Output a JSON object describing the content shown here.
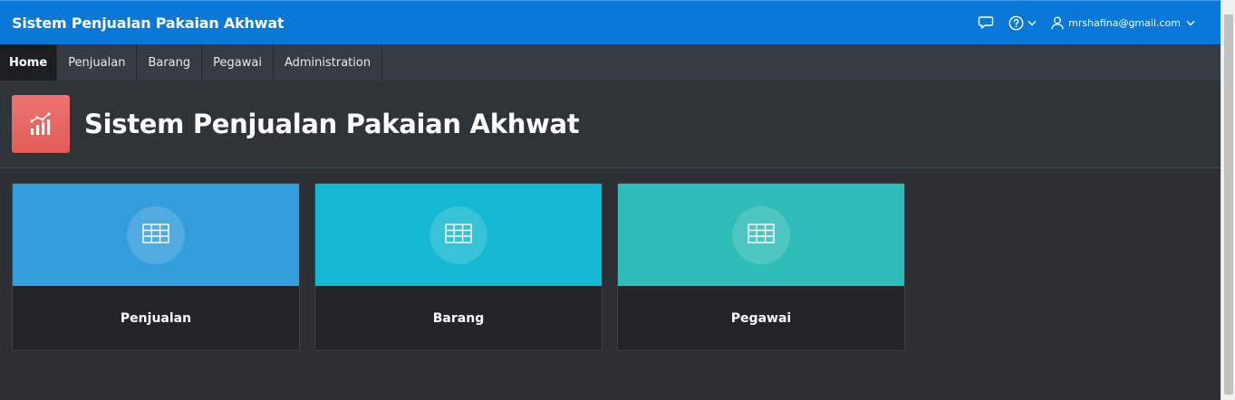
{
  "header": {
    "app_title": "Sistem Penjualan Pakaian Akhwat",
    "user_email": "mrshafina@gmail.com",
    "icons": [
      "chat-icon",
      "help-icon",
      "user-icon"
    ]
  },
  "nav": {
    "items": [
      {
        "label": "Home",
        "active": true
      },
      {
        "label": "Penjualan",
        "active": false
      },
      {
        "label": "Barang",
        "active": false
      },
      {
        "label": "Pegawai",
        "active": false
      },
      {
        "label": "Administration",
        "active": false
      }
    ]
  },
  "hero": {
    "title": "Sistem Penjualan Pakaian Akhwat",
    "icon": "chart-icon",
    "color": "#e7625f"
  },
  "cards": [
    {
      "label": "Penjualan",
      "color": "#349ddb",
      "icon": "table-icon"
    },
    {
      "label": "Barang",
      "color": "#14b8d2",
      "icon": "table-icon"
    },
    {
      "label": "Pegawai",
      "color": "#2ebdb8",
      "icon": "table-icon"
    }
  ],
  "colors": {
    "header_bg": "#0a78d8",
    "nav_bg": "#353c43",
    "page_bg": "#2c3034"
  }
}
